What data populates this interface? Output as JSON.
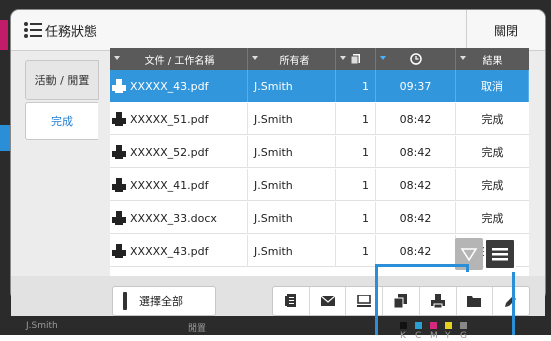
{
  "dialog": {
    "title": "任務狀態",
    "close_label": "關閉"
  },
  "tabs": [
    {
      "label": "活動 / 閒置",
      "active": false
    },
    {
      "label": "完成",
      "active": true
    }
  ],
  "table": {
    "headers": [
      "文件 / 工作名稱",
      "所有者",
      "",
      "",
      "結果"
    ],
    "rows": [
      {
        "name": "XXXXX_43.pdf",
        "owner": "J.Smith",
        "copies": "1",
        "time": "09:37",
        "result": "取消",
        "selected": true
      },
      {
        "name": "XXXXX_51.pdf",
        "owner": "J.Smith",
        "copies": "1",
        "time": "08:42",
        "result": "完成",
        "selected": false
      },
      {
        "name": "XXXXX_52.pdf",
        "owner": "J.Smith",
        "copies": "1",
        "time": "08:42",
        "result": "完成",
        "selected": false
      },
      {
        "name": "XXXXX_41.pdf",
        "owner": "J.Smith",
        "copies": "1",
        "time": "08:42",
        "result": "完成",
        "selected": false
      },
      {
        "name": "XXXXX_33.docx",
        "owner": "J.Smith",
        "copies": "1",
        "time": "08:42",
        "result": "完成",
        "selected": false
      },
      {
        "name": "XXXXX_43.pdf",
        "owner": "J.Smith",
        "copies": "1",
        "time": "08:42",
        "result": "完成",
        "selected": false
      }
    ]
  },
  "toolbar": {
    "select_all_label": "選擇全部",
    "icons": [
      "details-icon",
      "mail-icon",
      "computer-icon",
      "copy-icon",
      "print-icon",
      "folder-icon",
      "edit-icon"
    ]
  },
  "status_bar": {
    "user": "J.Smith",
    "state": "閒置",
    "ink_labels": [
      "K",
      "C",
      "M",
      "Y",
      "G"
    ]
  },
  "colors": {
    "accent": "#3296dc",
    "header_bg": "#5a5a5a",
    "callout": "#2a8fd6"
  }
}
